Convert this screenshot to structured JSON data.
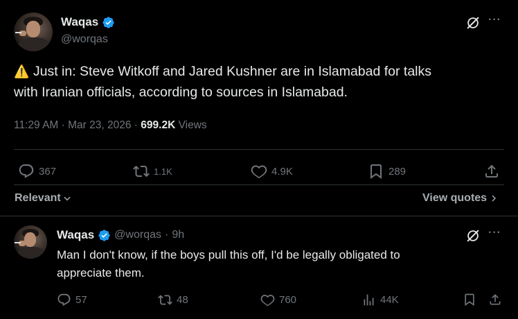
{
  "main_post": {
    "author_name": "Waqas",
    "author_handle": "@worqas",
    "warning_emoji": "⚠️",
    "text_line1": "Just in: Steve Witkoff and Jared Kushner are in Islamabad for talks",
    "text_line2": "with Iranian officials, according to sources in Islamabad.",
    "time": "11:29 AM",
    "date": "Mar 23, 2026",
    "sep1": "·",
    "sep2": "·",
    "views_count": "699.2K",
    "views_label": "Views",
    "actions": {
      "replies": "367",
      "reposts": "1.1K",
      "likes": "4.9K",
      "bookmarks": "289"
    },
    "more": "···"
  },
  "filters": {
    "sort_label": "Relevant",
    "quotes_label": "View quotes"
  },
  "reply_post": {
    "author_name": "Waqas",
    "author_handle": "@worqas",
    "sep": "·",
    "age": "9h",
    "text_line1": "Man I don't know, if the boys pull this off, I'd be legally obligated to",
    "text_line2": "appreciate them.",
    "actions": {
      "replies": "57",
      "reposts": "48",
      "likes": "760",
      "views": "44K"
    },
    "more": "···"
  },
  "colors": {
    "background": "#000000",
    "text": "#e7e9ea",
    "muted": "#71767b",
    "verified": "#1d9bf0",
    "divider": "#2f3336"
  }
}
